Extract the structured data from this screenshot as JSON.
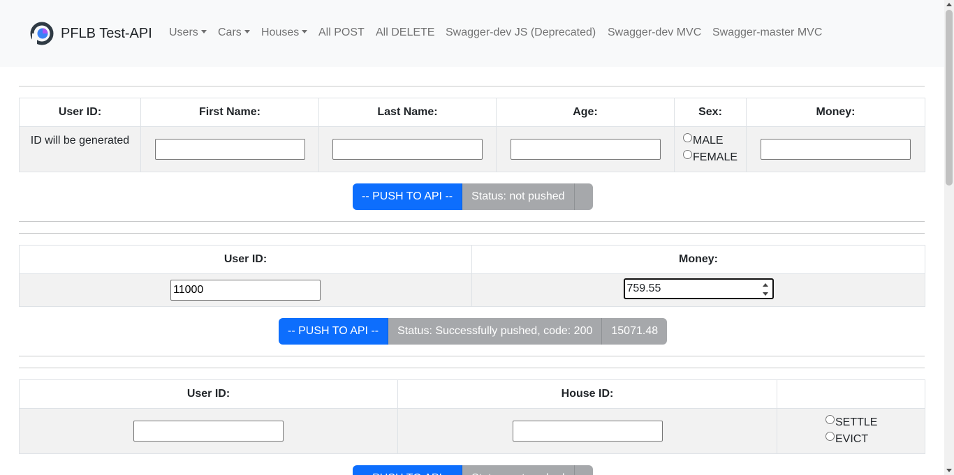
{
  "navbar": {
    "brand": "PFLB Test-API",
    "items": [
      {
        "label": "Users",
        "dropdown": true
      },
      {
        "label": "Cars",
        "dropdown": true
      },
      {
        "label": "Houses",
        "dropdown": true
      },
      {
        "label": "All POST",
        "dropdown": false
      },
      {
        "label": "All DELETE",
        "dropdown": false
      },
      {
        "label": "Swagger-dev JS (Deprecated)",
        "dropdown": false
      },
      {
        "label": "Swagger-dev MVC",
        "dropdown": false
      },
      {
        "label": "Swagger-master MVC",
        "dropdown": false
      }
    ]
  },
  "create_user": {
    "headers": [
      "User ID:",
      "First Name:",
      "Last Name:",
      "Age:",
      "Sex:",
      "Money:"
    ],
    "id_placeholder_text": "ID will be generated",
    "first_name": "",
    "last_name": "",
    "age": "",
    "sex_options": [
      "MALE",
      "FEMALE"
    ],
    "money": "",
    "push_label": "-- PUSH TO API --",
    "status": "Status: not pushed",
    "result": ""
  },
  "add_money": {
    "headers": [
      "User ID:",
      "Money:"
    ],
    "user_id": "11000",
    "money": "759.55",
    "push_label": "-- PUSH TO API --",
    "status": "Status: Successfully pushed, code: 200",
    "result": "15071.48"
  },
  "settle_house": {
    "headers": [
      "User ID:",
      "House ID:",
      ""
    ],
    "user_id": "",
    "house_id": "",
    "action_options": [
      "SETTLE",
      "EVICT"
    ],
    "push_label": "-- PUSH TO API --",
    "status": "Status: not pushed",
    "result": ""
  },
  "colors": {
    "primary": "#0d6efd",
    "secondary": "#a6a8ab",
    "navbar_bg": "#f8f9fa"
  }
}
